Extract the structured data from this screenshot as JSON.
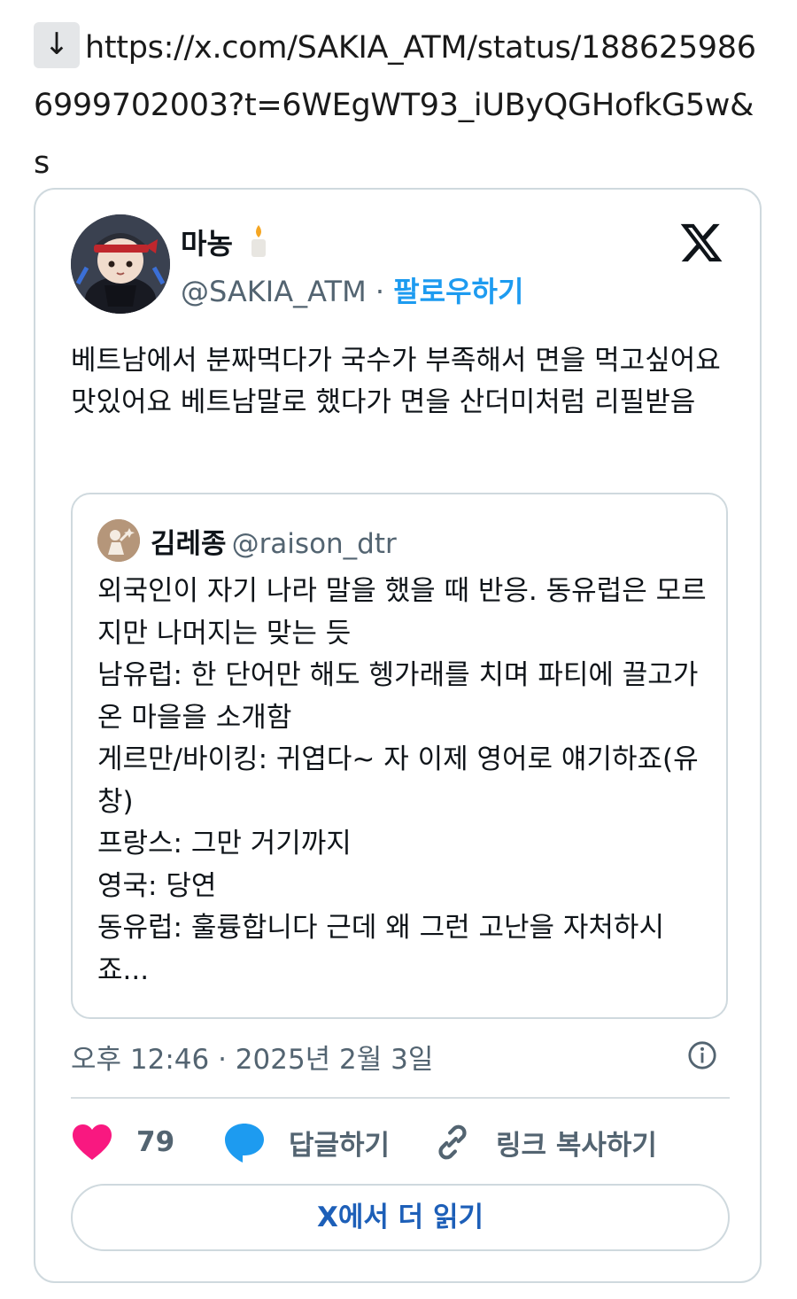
{
  "url": {
    "icon": "download-arrow-icon",
    "arrow": "↓",
    "text": "https://x.com/SAKIA_ATM/status/1886259866999702003?t=6WEgWT93_iUByQGHofkG5w&s"
  },
  "tweet": {
    "display_name": "마농",
    "name_emoji": "candle-icon",
    "handle": "@SAKIA_ATM",
    "separator": "·",
    "follow_label": "팔로우하기",
    "text": "베트남에서 분짜먹다가 국수가 부족해서 면을 먹고싶어요 맛있어요 베트남말로 했다가 면을 산더미처럼 리필받음",
    "timestamp": "오후 12:46 · 2025년 2월 3일",
    "like_count": "79",
    "reply_label": "답글하기",
    "copy_link_label": "링크 복사하기",
    "read_more_label": "X에서 더 읽기"
  },
  "quote": {
    "display_name": "김레종",
    "handle": "@raison_dtr",
    "text": "외국인이 자기 나라 말을 했을 때 반응. 동유럽은 모르지만 나머지는 맞는 듯\n남유럽: 한 단어만 해도 헹가래를 치며 파티에 끌고가 온 마을을 소개함\n게르만/바이킹: 귀엽다~ 자 이제 영어로 얘기하죠(유창)\n프랑스: 그만 거기까지\n영국: 당연\n동유럽: 훌륭합니다 근데 왜 그런 고난을 자처하시죠..."
  },
  "colors": {
    "accent": "#1d9bf0",
    "like": "#f91880",
    "reply": "#1d9bf0",
    "muted": "#536471",
    "border": "#cfd9de"
  }
}
